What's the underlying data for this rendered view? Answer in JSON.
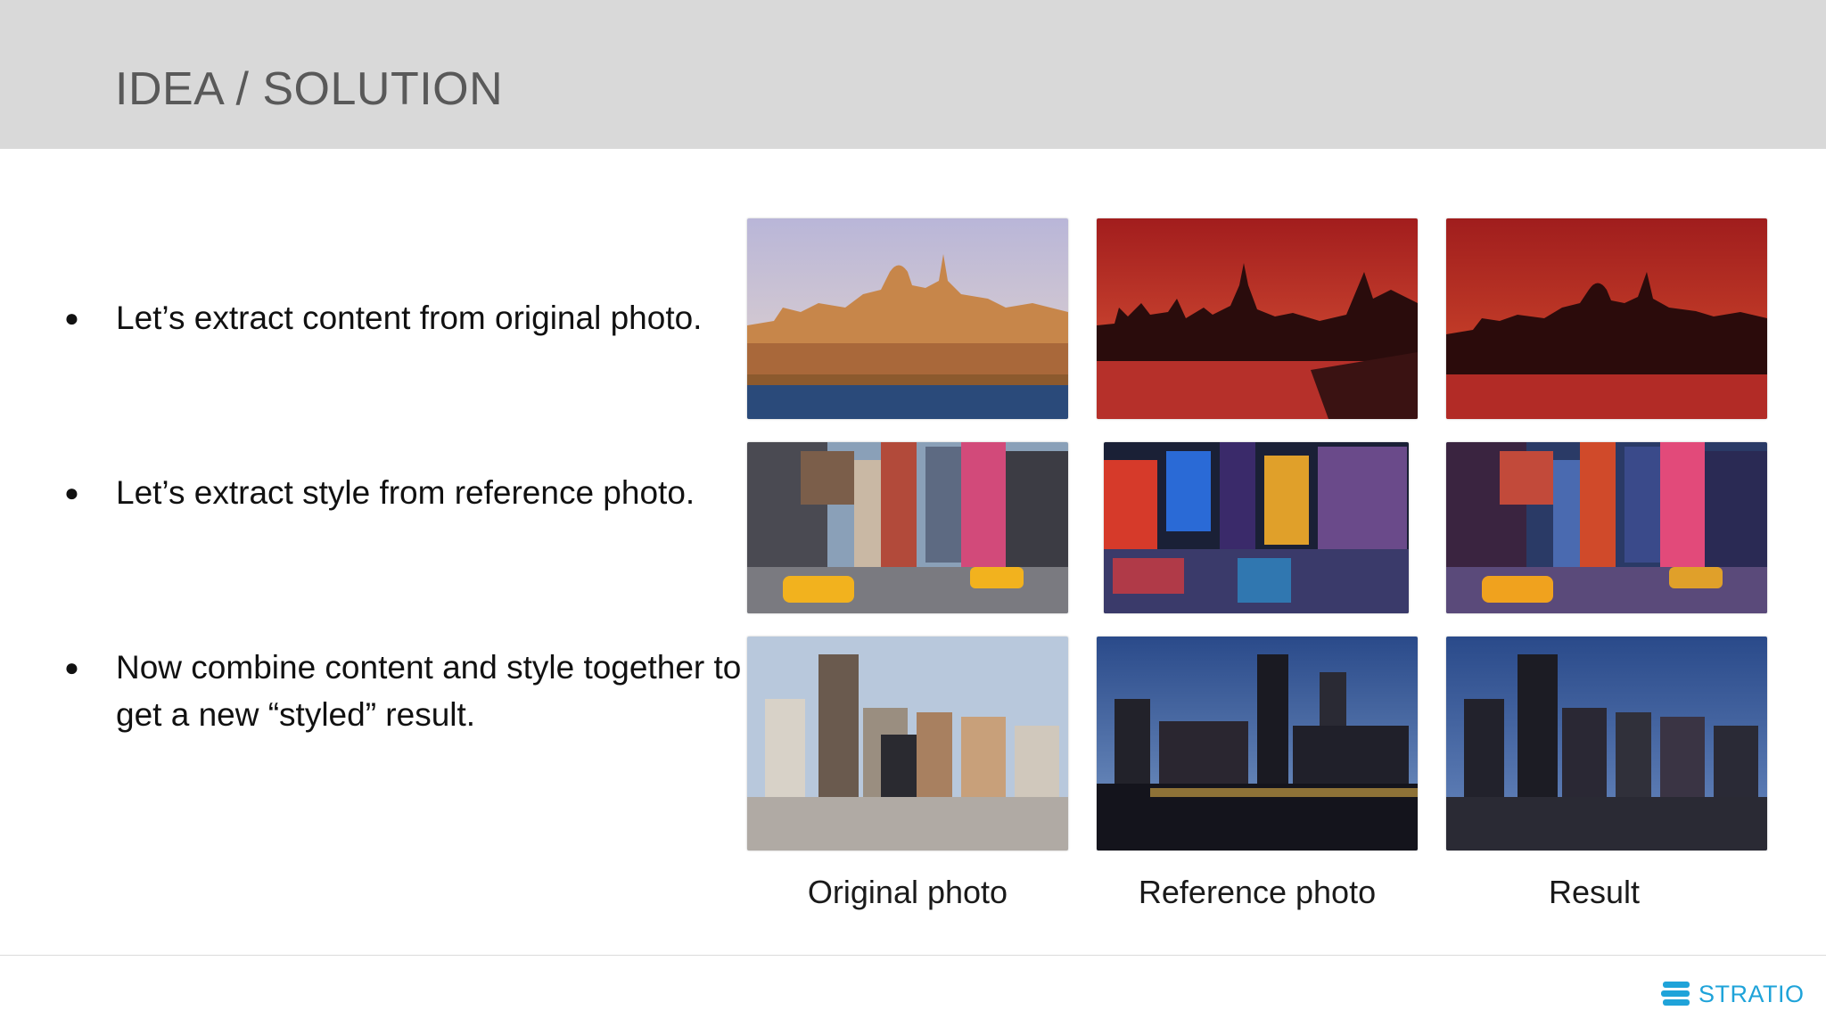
{
  "slide": {
    "title": "IDEA / SOLUTION"
  },
  "bullets": [
    {
      "marker": "●",
      "text": "Let’s extract content from original photo."
    },
    {
      "marker": "●",
      "text": "Let’s extract style from reference photo."
    },
    {
      "marker": "●",
      "text": "Now combine content and style together to get a new “styled” result."
    }
  ],
  "figure": {
    "captions": [
      "Original photo",
      "Reference photo",
      "Result"
    ],
    "rows": [
      {
        "subject": "skyline-domed-city",
        "original": "golden daylight",
        "reference": "red sunset skyline",
        "result": "red-toned domed city"
      },
      {
        "subject": "times-square-street",
        "original": "daytime street",
        "reference": "neon night street",
        "result": "neon-toned street"
      },
      {
        "subject": "downtown-skyscrapers",
        "original": "daytime city",
        "reference": "night waterfront",
        "result": "night-toned city"
      }
    ]
  },
  "brand": {
    "name": "STRATIO",
    "color": "#1fa3d9"
  },
  "colors": {
    "header_bg": "#d9d9d9",
    "title_text": "#595959"
  }
}
